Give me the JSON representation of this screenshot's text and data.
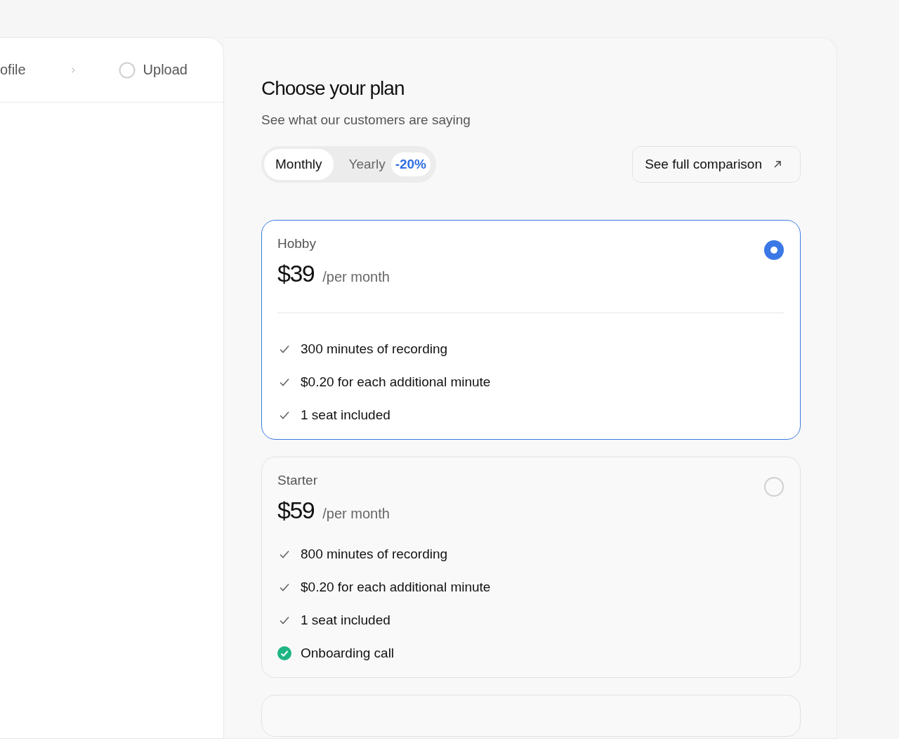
{
  "steps": [
    {
      "label": "ofile",
      "kind": "partial"
    },
    {
      "label": "Upload",
      "kind": "pending"
    }
  ],
  "plan_picker": {
    "title": "Choose your plan",
    "subtitle": "See what our customers are saying",
    "billing": [
      {
        "label": "Monthly",
        "selected": true
      },
      {
        "label": "Yearly",
        "selected": false,
        "badge": "-20%"
      }
    ],
    "comparison_link": "See full comparison",
    "plans": [
      {
        "name": "Hobby",
        "price": "$39",
        "period": "/per month",
        "selected": true,
        "features": [
          {
            "text": "300 minutes of recording",
            "kind": "check"
          },
          {
            "text": "$0.20 for each additional minute",
            "kind": "check"
          },
          {
            "text": "1 seat included",
            "kind": "check"
          }
        ]
      },
      {
        "name": "Starter",
        "price": "$59",
        "period": "/per month",
        "selected": false,
        "features": [
          {
            "text": "800 minutes of recording",
            "kind": "check"
          },
          {
            "text": "$0.20 for each additional minute",
            "kind": "check"
          },
          {
            "text": "1 seat included",
            "kind": "check"
          },
          {
            "text": "Onboarding call",
            "kind": "highlight"
          }
        ]
      }
    ]
  }
}
